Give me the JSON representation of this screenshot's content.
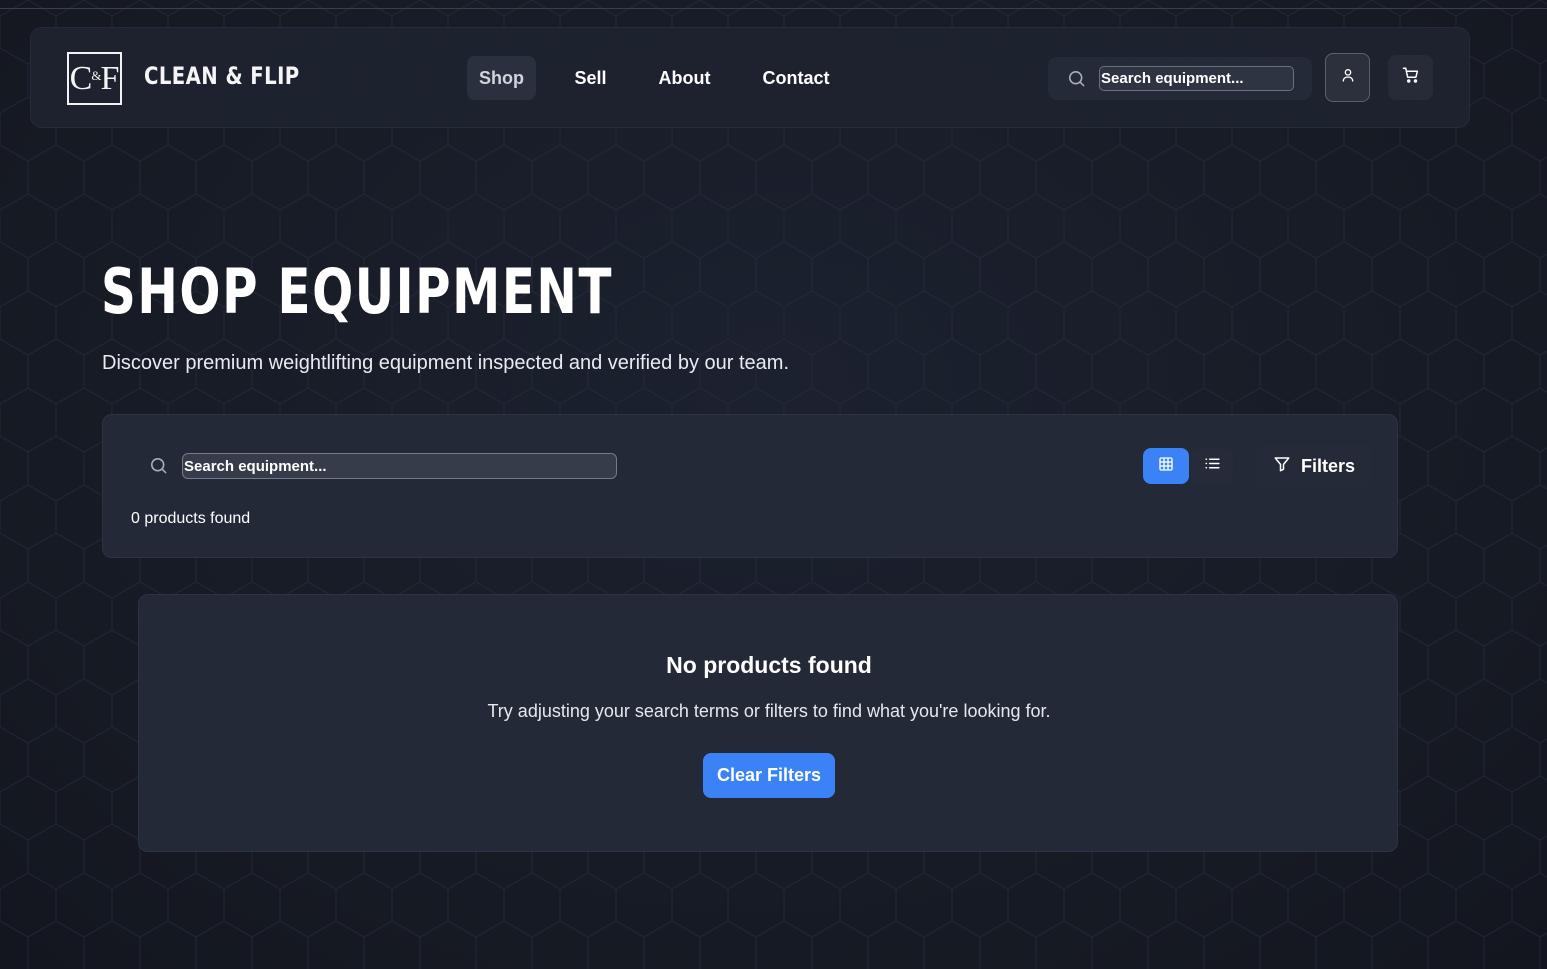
{
  "header": {
    "logo_letters_left": "C",
    "logo_amp": "&",
    "logo_letters_right": "F",
    "brand": "CLEAN & FLIP",
    "nav": [
      {
        "label": "Shop",
        "active": true
      },
      {
        "label": "Sell",
        "active": false
      },
      {
        "label": "About",
        "active": false
      },
      {
        "label": "Contact",
        "active": false
      }
    ],
    "search_placeholder": "Search equipment...",
    "icons": [
      "search-icon",
      "user-icon",
      "cart-icon"
    ]
  },
  "hero": {
    "title": "SHOP EQUIPMENT",
    "subtitle": "Discover premium weightlifting equipment inspected and verified by our team."
  },
  "toolbar": {
    "search_placeholder": "Search equipment...",
    "product_count": "0 products found",
    "view_mode": "grid",
    "filters_label": "Filters"
  },
  "empty_state": {
    "title": "No products found",
    "text": "Try adjusting your search terms or filters to find what you're looking for.",
    "button_label": "Clear Filters"
  },
  "colors": {
    "accent": "#3b82f6",
    "background": "#181c26",
    "card": "#242938"
  }
}
